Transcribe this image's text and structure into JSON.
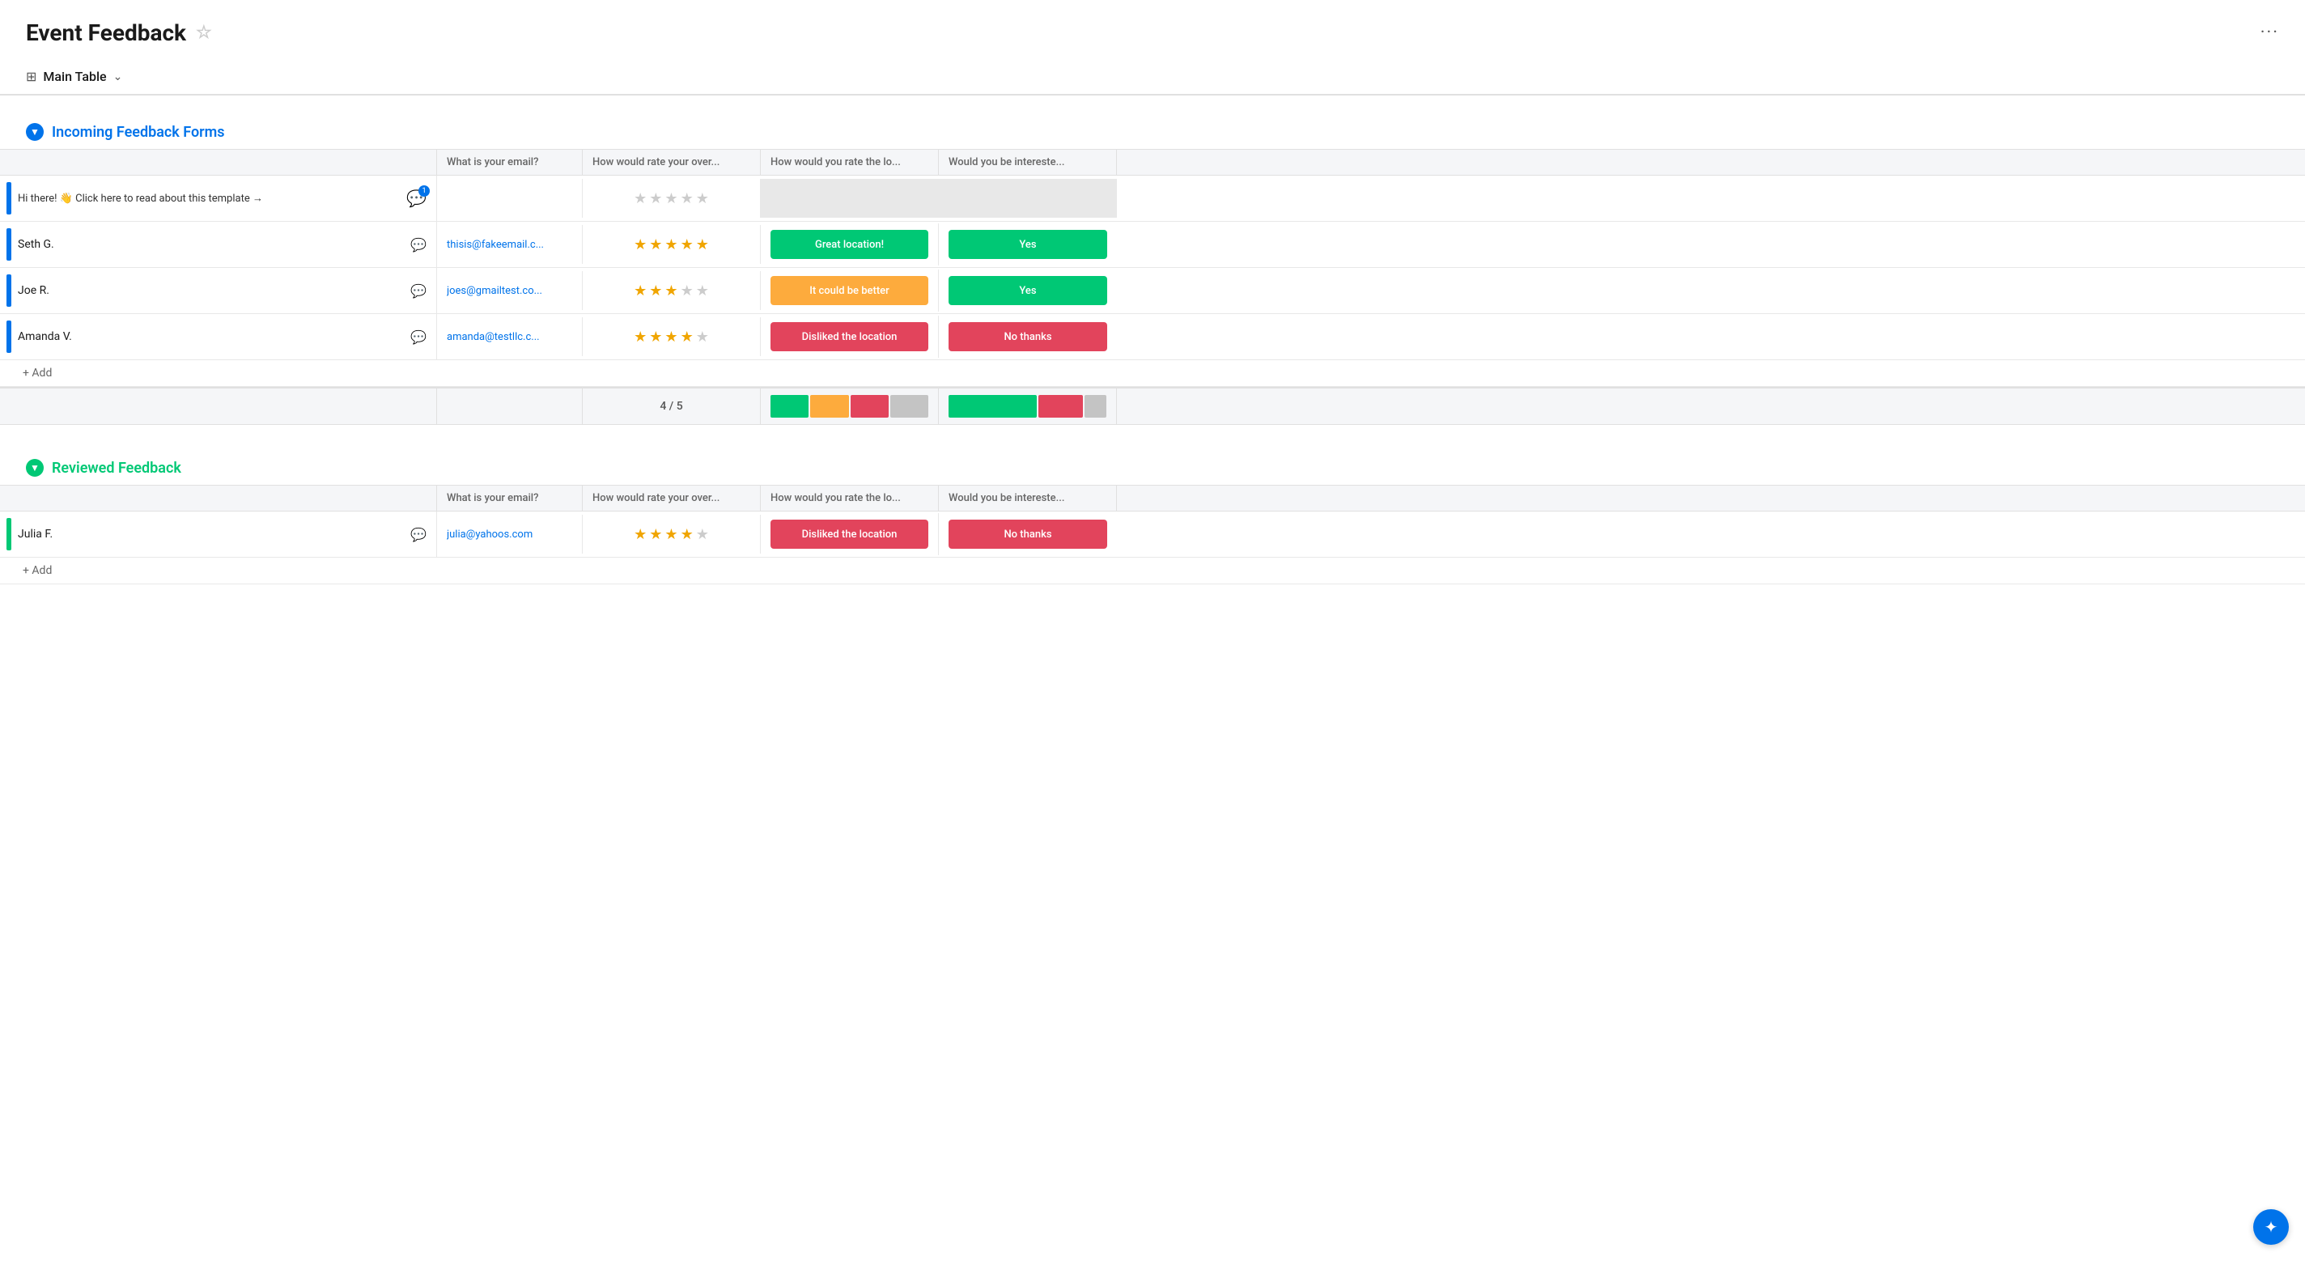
{
  "header": {
    "title": "Event Feedback",
    "more_menu": "···"
  },
  "toolbar": {
    "icon": "⊞",
    "view_label": "Main Table",
    "chevron": "∨"
  },
  "columns": {
    "name": "",
    "email": "What is your email?",
    "overall": "How would rate your over...",
    "location": "How would you rate the lo...",
    "interested": "Would you be intereste..."
  },
  "groups": [
    {
      "id": "incoming",
      "toggle_char": "▼",
      "color_class": "blue",
      "title": "Incoming Feedback Forms",
      "rows": [
        {
          "id": "template",
          "name": "Hi there! 👋 Click here to read about this template →",
          "color": "#0073ea",
          "has_chat_badge": true,
          "badge_num": "1",
          "email": "",
          "stars": [
            false,
            false,
            false,
            false,
            false
          ],
          "location_status": "",
          "location_color": "gray",
          "interested_status": "",
          "interested_color": "gray"
        },
        {
          "id": "seth",
          "name": "Seth G.",
          "color": "#0073ea",
          "has_chat_badge": false,
          "email": "thisis@fakeemail.c...",
          "stars": [
            true,
            true,
            true,
            true,
            true
          ],
          "location_status": "Great location!",
          "location_color": "green",
          "interested_status": "Yes",
          "interested_color": "green"
        },
        {
          "id": "joe",
          "name": "Joe R.",
          "color": "#0073ea",
          "has_chat_badge": false,
          "email": "joes@gmailtest.co...",
          "stars": [
            true,
            true,
            true,
            false,
            false
          ],
          "location_status": "It could be better",
          "location_color": "orange",
          "interested_status": "Yes",
          "interested_color": "green"
        },
        {
          "id": "amanda",
          "name": "Amanda V.",
          "color": "#0073ea",
          "has_chat_badge": false,
          "email": "amanda@testllc.c...",
          "stars": [
            true,
            true,
            true,
            true,
            false
          ],
          "location_status": "Disliked the location",
          "location_color": "red",
          "interested_status": "No thanks",
          "interested_color": "red"
        }
      ],
      "summary": {
        "fraction": "4 / 5",
        "location_bars": [
          "green",
          "orange",
          "red",
          "gray"
        ],
        "interested_bars": [
          "green",
          "red",
          "gray"
        ]
      }
    },
    {
      "id": "reviewed",
      "toggle_char": "▼",
      "color_class": "green",
      "title": "Reviewed Feedback",
      "rows": [
        {
          "id": "julia",
          "name": "Julia F.",
          "color": "#00c875",
          "has_chat_badge": false,
          "email": "julia@yahoos.com",
          "stars": [
            true,
            true,
            true,
            true,
            false
          ],
          "location_status": "Disliked the location",
          "location_color": "red",
          "interested_status": "No thanks",
          "interested_color": "red"
        }
      ]
    }
  ],
  "add_row_label": "+ Add",
  "fab_icon": "✦"
}
